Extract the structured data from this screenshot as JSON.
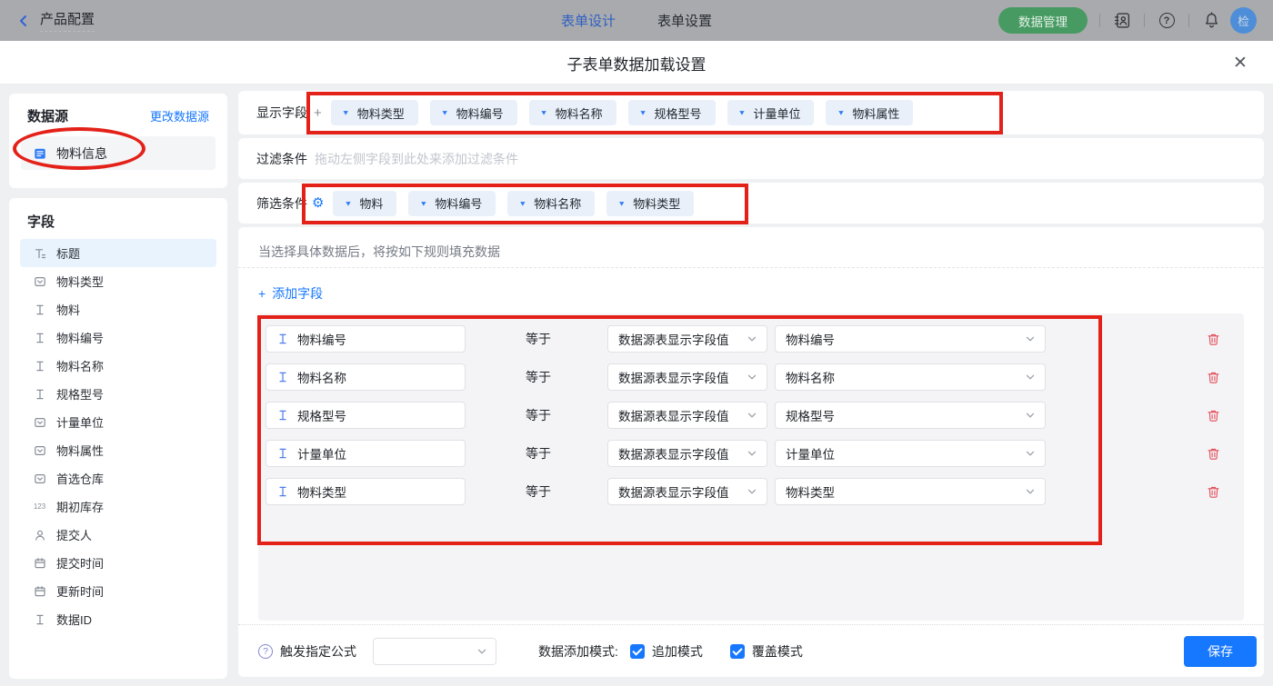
{
  "topbar": {
    "back_label": "产品配置",
    "tabs": [
      {
        "label": "表单设计"
      },
      {
        "label": "表单设置"
      }
    ],
    "data_manage": "数据管理",
    "avatar": "检"
  },
  "modal": {
    "title": "子表单数据加载设置",
    "sidebar": {
      "datasource_title": "数据源",
      "change_link": "更改数据源",
      "datasource_name": "物料信息",
      "fields_title": "字段",
      "fields": [
        {
          "label": "标题",
          "type": "title"
        },
        {
          "label": "物料类型",
          "type": "select"
        },
        {
          "label": "物料",
          "type": "text"
        },
        {
          "label": "物料编号",
          "type": "text"
        },
        {
          "label": "物料名称",
          "type": "text"
        },
        {
          "label": "规格型号",
          "type": "text"
        },
        {
          "label": "计量单位",
          "type": "select"
        },
        {
          "label": "物料属性",
          "type": "select"
        },
        {
          "label": "首选仓库",
          "type": "select"
        },
        {
          "label": "期初库存",
          "type": "number"
        },
        {
          "label": "提交人",
          "type": "user"
        },
        {
          "label": "提交时间",
          "type": "date"
        },
        {
          "label": "更新时间",
          "type": "date"
        },
        {
          "label": "数据ID",
          "type": "text"
        }
      ]
    },
    "display": {
      "label": "显示字段",
      "tags": [
        "物料类型",
        "物料编号",
        "物料名称",
        "规格型号",
        "计量单位",
        "物料属性"
      ]
    },
    "filter": {
      "label": "过滤条件",
      "placeholder": "拖动左侧字段到此处来添加过滤条件"
    },
    "screen": {
      "label": "筛选条件",
      "tags": [
        "物料",
        "物料编号",
        "物料名称",
        "物料类型"
      ]
    },
    "rules": {
      "hint": "当选择具体数据后，将按如下规则填充数据",
      "add_label": "添加字段",
      "equals": "等于",
      "rows": [
        {
          "field": "物料编号",
          "source": "数据源表显示字段值",
          "target": "物料编号"
        },
        {
          "field": "物料名称",
          "source": "数据源表显示字段值",
          "target": "物料名称"
        },
        {
          "field": "规格型号",
          "source": "数据源表显示字段值",
          "target": "规格型号"
        },
        {
          "field": "计量单位",
          "source": "数据源表显示字段值",
          "target": "计量单位"
        },
        {
          "field": "物料类型",
          "source": "数据源表显示字段值",
          "target": "物料类型"
        }
      ]
    },
    "footer": {
      "formula_label": "触发指定公式",
      "mode_label": "数据添加模式:",
      "append": "追加模式",
      "overwrite": "覆盖模式",
      "save": "保存"
    }
  },
  "icons": {
    "plus": "+",
    "caret": "▼",
    "gear": "⚙",
    "question": "?",
    "close": "✕",
    "number": "123"
  },
  "colors": {
    "accent": "#1677ff",
    "topbar_green": "#479b62",
    "annotation_red": "#e32119",
    "trash_red": "#e34d59"
  }
}
